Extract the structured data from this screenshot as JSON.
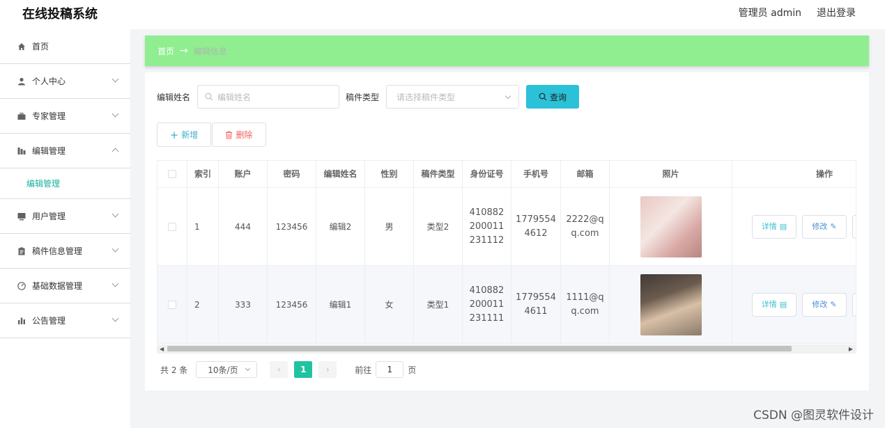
{
  "header": {
    "title": "在线投稿系统",
    "admin": "管理员 admin",
    "logout": "退出登录"
  },
  "sidebar": {
    "items": [
      {
        "label": "首页",
        "icon": "home-icon"
      },
      {
        "label": "个人中心",
        "icon": "user-icon"
      },
      {
        "label": "专家管理",
        "icon": "briefcase-icon"
      },
      {
        "label": "编辑管理",
        "icon": "chart-icon"
      },
      {
        "label": "用户管理",
        "icon": "monitor-icon"
      },
      {
        "label": "稿件信息管理",
        "icon": "clipboard-icon"
      },
      {
        "label": "基础数据管理",
        "icon": "gauge-icon"
      },
      {
        "label": "公告管理",
        "icon": "bar-chart-icon"
      }
    ],
    "submenu": "编辑管理"
  },
  "breadcrumb": {
    "home": "首页",
    "arrow": "→",
    "current": "编辑信息"
  },
  "search": {
    "name_label": "编辑姓名",
    "name_placeholder": "编辑姓名",
    "type_label": "稿件类型",
    "type_placeholder": "请选择稿件类型",
    "button": "查询"
  },
  "actions": {
    "add": "新增",
    "delete": "删除"
  },
  "table": {
    "headers": [
      "索引",
      "账户",
      "密码",
      "编辑姓名",
      "性别",
      "稿件类型",
      "身份证号",
      "手机号",
      "邮箱",
      "照片",
      "操作"
    ],
    "rows": [
      {
        "index": "1",
        "account": "444",
        "password": "123456",
        "name": "编辑2",
        "gender": "男",
        "type": "类型2",
        "id_card": "410882200011231112",
        "phone": "17795544612",
        "email": "2222@qq.com"
      },
      {
        "index": "2",
        "account": "333",
        "password": "123456",
        "name": "编辑1",
        "gender": "女",
        "type": "类型1",
        "id_card": "410882200011231111",
        "phone": "17795544611",
        "email": "1111@qq.com"
      }
    ],
    "detail_btn": "详情",
    "edit_btn": "修改"
  },
  "pagination": {
    "total": "共 2 条",
    "page_size": "10条/页",
    "current": "1",
    "goto_label": "前往",
    "goto_value": "1",
    "page_suffix": "页"
  },
  "watermark": "CSDN @图灵软件设计",
  "colors": {
    "breadcrumb_bg": "#90ee90",
    "accent": "#20c3a0",
    "search_btn": "#2ac1d9"
  }
}
